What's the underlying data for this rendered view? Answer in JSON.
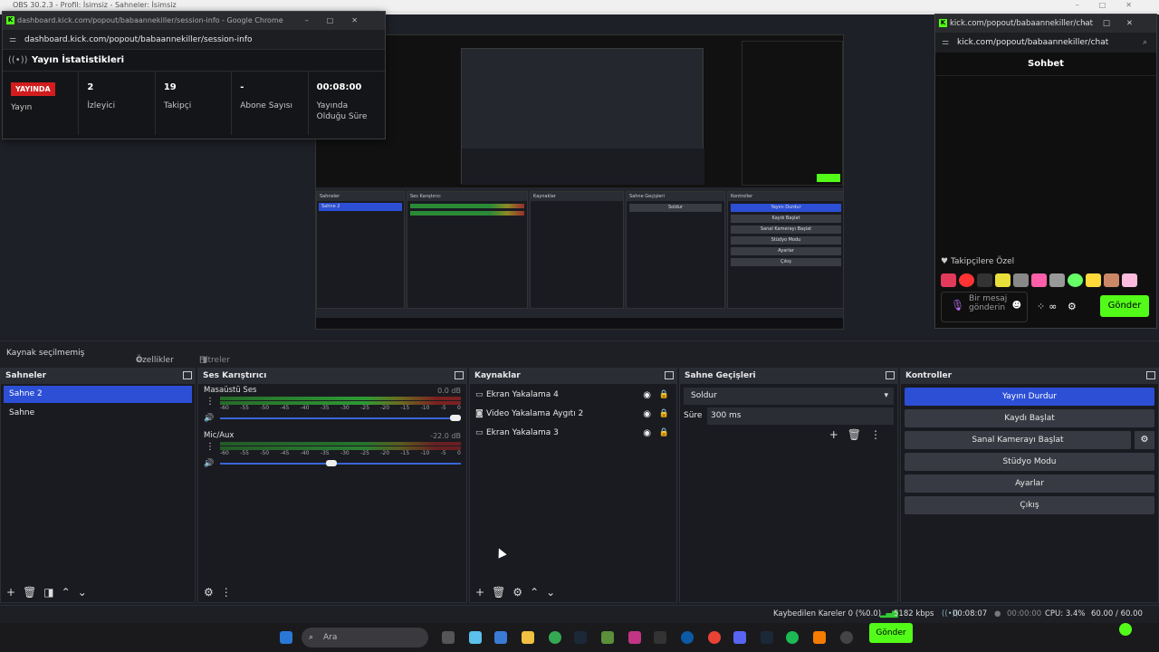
{
  "obs": {
    "title": "OBS 30.2.3 - Profil: İsimsiz - Sahneler: İsimsiz",
    "window_controls": [
      "–",
      "□",
      "✕"
    ]
  },
  "stats_window": {
    "title": "dashboard.kick.com/popout/babaannekiller/session-info - Google Chrome",
    "url": "dashboard.kick.com/popout/babaannekiller/session-info",
    "header": "Yayın İstatistikleri",
    "live_badge": "YAYINDA",
    "live_label": "Yayın",
    "stats": [
      {
        "value": "2",
        "label": "İzleyici"
      },
      {
        "value": "19",
        "label": "Takipçi"
      },
      {
        "value": "-",
        "label": "Abone Sayısı"
      },
      {
        "value": "00:08:00",
        "label": "Yayında Olduğu Süre"
      }
    ]
  },
  "chat_window": {
    "title": "kick.com/popout/babaannekiller/chat",
    "url": "kick.com/popout/babaannekiller/chat",
    "header": "Sohbet",
    "followers_label": "Takipçilere Özel",
    "input_placeholder": "Bir mesaj gönderin",
    "send_label": "Gönder",
    "emote_colors": [
      "#e23a5a",
      "#f33",
      "#333",
      "#e8e03a",
      "#888",
      "#ff5ea8",
      "#999",
      "#6f6",
      "#ffd83b",
      "#c86",
      "#fbd"
    ]
  },
  "source_bar": {
    "no_source": "Kaynak seçilmemiş",
    "properties": "Özellikler",
    "filters": "Filtreler"
  },
  "scenes": {
    "title": "Sahneler",
    "items": [
      {
        "label": "Sahne 2",
        "selected": true
      },
      {
        "label": "Sahne",
        "selected": false
      }
    ]
  },
  "mixer": {
    "title": "Ses Karıştırıcı",
    "ticks": [
      "-60",
      "-55",
      "-50",
      "-45",
      "-40",
      "-35",
      "-30",
      "-25",
      "-20",
      "-15",
      "-10",
      "-5",
      "0"
    ],
    "channels": [
      {
        "name": "Masaüstü Ses",
        "db": "0.0 dB",
        "volume": 1.0
      },
      {
        "name": "Mic/Aux",
        "db": "-22.0 dB",
        "volume": 0.46
      }
    ]
  },
  "sources": {
    "title": "Kaynaklar",
    "items": [
      {
        "label": "Ekran Yakalama 4",
        "icon": "monitor-icon"
      },
      {
        "label": "Video Yakalama Aygıtı 2",
        "icon": "camera-icon"
      },
      {
        "label": "Ekran Yakalama 3",
        "icon": "monitor-icon"
      }
    ]
  },
  "transitions": {
    "title": "Sahne Geçişleri",
    "selected": "Soldur",
    "duration_label": "Süre",
    "duration_value": "300 ms"
  },
  "controls": {
    "title": "Kontroller",
    "stop_stream": "Yayını Durdur",
    "start_recording": "Kaydı Başlat",
    "virtual_cam": "Sanal Kamerayı Başlat",
    "studio_mode": "Stüdyo Modu",
    "settings": "Ayarlar",
    "exit": "Çıkış"
  },
  "status": {
    "dropped": "Kaybedilen Kareler 0 (%0.0)",
    "bitrate": "5182 kbps",
    "live_time": "00:08:07",
    "rec_time": "00:00:00",
    "cpu": "CPU: 3.4%",
    "fps": "60.00 / 60.00 FPS"
  },
  "taskbar": {
    "search_placeholder": "Ara",
    "send_label": "Gönder"
  }
}
